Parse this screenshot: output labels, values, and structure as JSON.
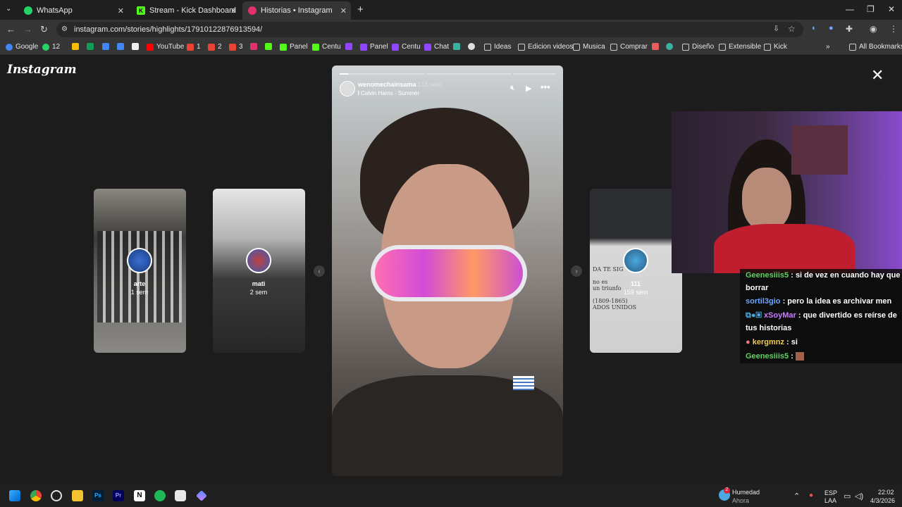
{
  "browser": {
    "tabs": [
      {
        "label": "WhatsApp",
        "color": "#25d366"
      },
      {
        "label": "Stream - Kick Dashboard",
        "color": "#53fc18"
      },
      {
        "label": "Historias • Instagram",
        "color": "#e1306c"
      }
    ],
    "url": "instagram.com/stories/highlights/17910122876913594/",
    "bookmarks": [
      "Google",
      "12",
      "YouTube",
      "1",
      "2",
      "3",
      "Panel",
      "Centu",
      "Panel",
      "Centu",
      "Chat",
      "Ideas",
      "Edicion videos",
      "Musica",
      "Comprar",
      "Diseño",
      "Extensible",
      "Kick"
    ],
    "all_bookmarks": "All Bookmarks"
  },
  "instagram": {
    "logo": "Instagram",
    "story": {
      "username": "wenomechainsama",
      "age": "118 sem",
      "song": "Calvin Harris · Summer"
    },
    "side_stories": [
      {
        "name": "arte",
        "age": "1 sem"
      },
      {
        "name": "mati",
        "age": "2 sem"
      },
      {
        "name": "111",
        "age": "159 sem"
      }
    ]
  },
  "chat": [
    {
      "user": "Geenesiiis5",
      "color": "#5fd35f",
      "text": "si de vez en cuando hay que borrar"
    },
    {
      "user": "sortil3gio",
      "color": "#6aa9ff",
      "text": "pero la idea es archivar men"
    },
    {
      "user": "xSoyMar",
      "color": "#c77dff",
      "text": "que divertido es reírse de tus historias"
    },
    {
      "user": "kergmnz",
      "color": "#f2c94c",
      "text": "si"
    },
    {
      "user": "Geenesiiis5",
      "color": "#5fd35f",
      "text": ""
    }
  ],
  "taskbar": {
    "weather_title": "Humedad",
    "weather_sub": "Ahora",
    "lang": "ESP",
    "lang2": "LAA",
    "time": "22:02",
    "date": "4/3/2026",
    "badge": "2"
  }
}
